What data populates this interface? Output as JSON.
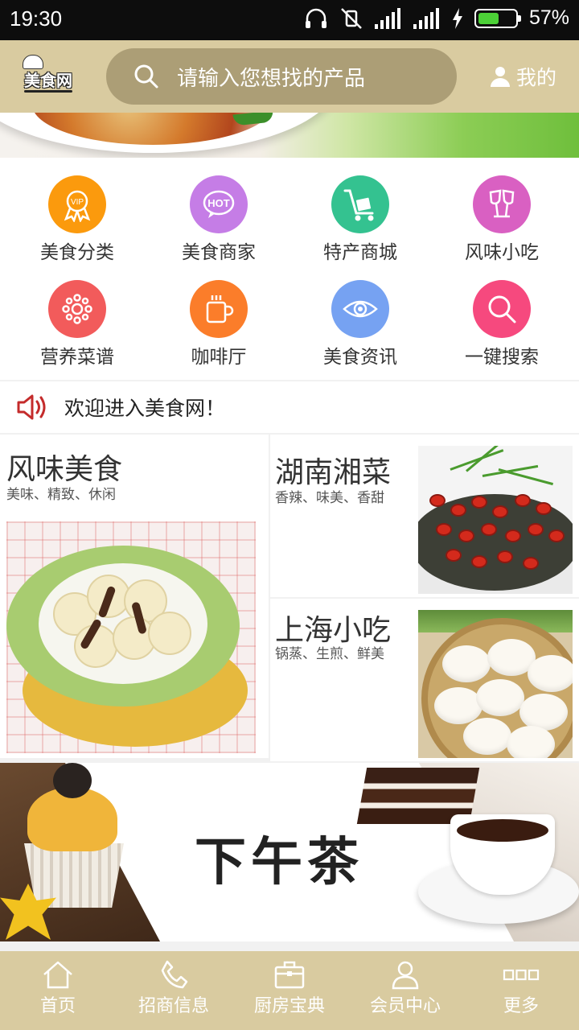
{
  "status_bar": {
    "time": "19:30",
    "battery": "57%",
    "battery_level": 0.57
  },
  "header": {
    "logo_text": "美食网",
    "search_placeholder": "请输入您想找的产品",
    "mine_label": "我的"
  },
  "categories": [
    {
      "label": "美食分类",
      "icon": "vip-ribbon-icon",
      "color": "#fb9a0d"
    },
    {
      "label": "美食商家",
      "icon": "hot-icon",
      "color": "#c57de6"
    },
    {
      "label": "特产商城",
      "icon": "cart-icon",
      "color": "#34c290"
    },
    {
      "label": "风味小吃",
      "icon": "wine-glasses-icon",
      "color": "#d960c2"
    },
    {
      "label": "营养菜谱",
      "icon": "flower-icon",
      "color": "#f25b5b"
    },
    {
      "label": "咖啡厅",
      "icon": "coffee-cup-icon",
      "color": "#fb7d2a"
    },
    {
      "label": "美食资讯",
      "icon": "eye-icon",
      "color": "#76a2f2"
    },
    {
      "label": "一键搜索",
      "icon": "search-icon",
      "color": "#f6497e"
    }
  ],
  "notice": {
    "text": "欢迎进入美食网！",
    "icon": "speaker-icon",
    "icon_color": "#c42b2b"
  },
  "food_sections": [
    {
      "title": "风味美食",
      "subtitle": "美味、精致、休闲"
    },
    {
      "title": "湖南湘菜",
      "subtitle": "香辣、味美、香甜"
    },
    {
      "title": "上海小吃",
      "subtitle": "锅蒸、生煎、鲜美"
    }
  ],
  "tea_banner": {
    "title": "下午茶"
  },
  "bottom_nav": [
    {
      "label": "首页",
      "icon": "home-icon"
    },
    {
      "label": "招商信息",
      "icon": "phone-icon"
    },
    {
      "label": "厨房宝典",
      "icon": "briefcase-icon"
    },
    {
      "label": "会员中心",
      "icon": "user-icon"
    },
    {
      "label": "更多",
      "icon": "more-icon"
    }
  ],
  "colors": {
    "header_bg": "#d9cba0",
    "search_bg": "#ac9e76"
  }
}
